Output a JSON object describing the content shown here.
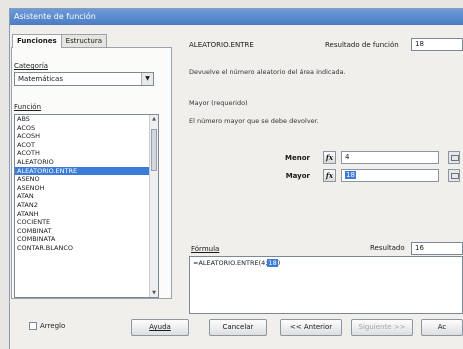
{
  "window": {
    "title": "Asistente de función"
  },
  "tabs": [
    {
      "label": "Funciones",
      "active": true
    },
    {
      "label": "Estructura",
      "active": false
    }
  ],
  "category": {
    "label": "Categoría",
    "value": "Matemáticas"
  },
  "function_list": {
    "label": "Función",
    "items": [
      "ABS",
      "ACOS",
      "ACOSH",
      "ACOT",
      "ACOTH",
      "ALEATORIO",
      "ALEATORIO.ENTRE",
      "ASENO",
      "ASENOH",
      "ATAN",
      "ATAN2",
      "ATANH",
      "COCIENTE",
      "COMBINAT",
      "COMBINATA",
      "CONTAR.BLANCO"
    ],
    "selected_index": 6
  },
  "function_name": "ALEATORIO.ENTRE",
  "function_result": {
    "label": "Resultado de función",
    "value": "18"
  },
  "description": "Devuelve el número aleatorio del área indicada.",
  "param_title": "Mayor (requerido)",
  "param_description": "El número mayor que se debe devolver.",
  "args": [
    {
      "label": "Menor",
      "value": "4",
      "highlighted": false
    },
    {
      "label": "Mayor",
      "value": "18",
      "highlighted": true
    }
  ],
  "formula": {
    "label": "Fórmula",
    "text": "=ALEATORIO.ENTRE(4;",
    "highlight": "18",
    "suffix": ")"
  },
  "result": {
    "label": "Resultado",
    "value": "16"
  },
  "bottom": {
    "array_label": "Arreglo",
    "help": "Ayuda",
    "cancel": "Cancelar",
    "back": "<< Anterior",
    "next": "Siguiente >>",
    "ok": "Ac"
  },
  "icons": {
    "fx": "fx-icon",
    "shrink": "shrink-icon"
  },
  "colors": {
    "titlebar": "#4b7cc4",
    "selection": "#3d7bd9",
    "window_bg": "#f0efec"
  }
}
